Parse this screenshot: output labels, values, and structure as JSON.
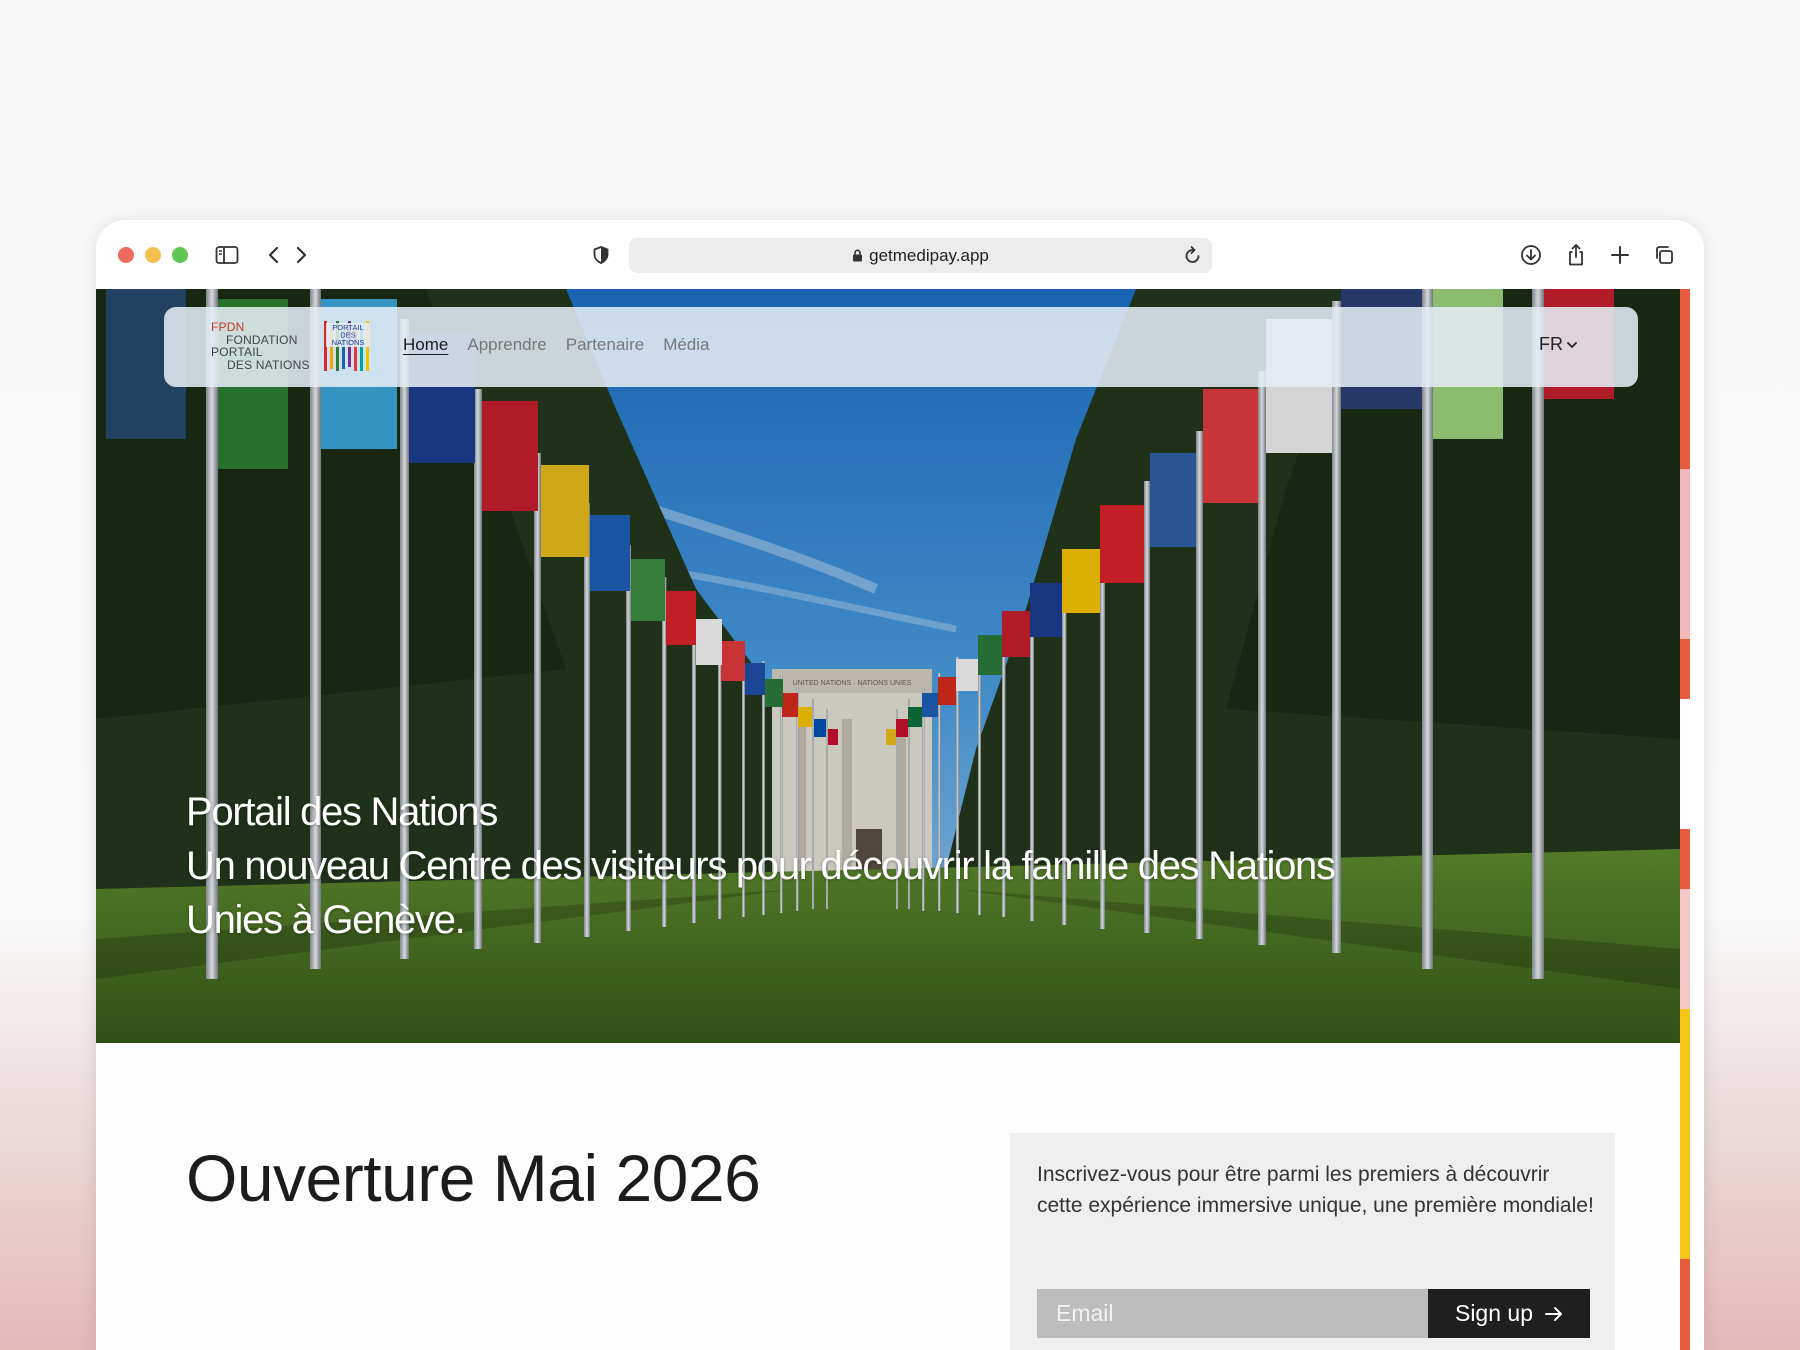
{
  "browser": {
    "url": "getmedipay.app"
  },
  "nav": {
    "logo": {
      "line1": "FPDN",
      "line2": "FONDATION",
      "line3": "PORTAIL",
      "line4": "DES NATIONS",
      "mark_text": "PORTAIL DES NATIONS"
    },
    "links": [
      {
        "label": "Home",
        "active": true
      },
      {
        "label": "Apprendre",
        "active": false
      },
      {
        "label": "Partenaire",
        "active": false
      },
      {
        "label": "Média",
        "active": false
      }
    ],
    "language": "FR"
  },
  "hero": {
    "title": "Portail des Nations",
    "subtitle_line1": "Un nouveau Centre des visiteurs pour découvrir la famille des Nations",
    "subtitle_line2": "Unies à Genève.",
    "building_inscription": "UNITED NATIONS · NATIONS UNIES"
  },
  "content": {
    "heading": "Ouverture Mai 2026",
    "signup": {
      "text": "Inscrivez-vous pour être parmi les premiers à découvrir cette expérience immersive unique, une première mondiale!",
      "email_placeholder": "Email",
      "button_label": "Sign up"
    }
  },
  "colors": {
    "dot_red": "#ec6a5e",
    "dot_yellow": "#f4bf4f",
    "dot_green": "#61c554",
    "button_bg": "#1f1f1f",
    "email_bg": "#bdbdbd",
    "card_bg": "#efefef"
  },
  "icons": [
    "sidebar-icon",
    "back-icon",
    "forward-icon",
    "shield-icon",
    "lock-icon",
    "reload-icon",
    "download-icon",
    "share-icon",
    "new-tab-icon",
    "tabs-overview-icon",
    "chevron-down-icon",
    "arrow-right-icon"
  ]
}
